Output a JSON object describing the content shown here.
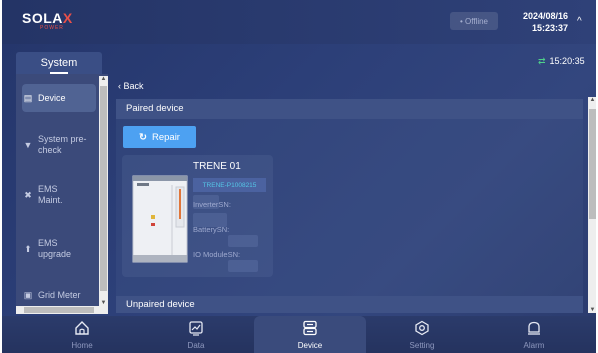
{
  "header": {
    "logo_main": "SOLA",
    "logo_x": "X",
    "logo_sub": "POWER",
    "status": "• Offline",
    "date": "2024/08/16",
    "time": "15:23:37"
  },
  "sidebar": {
    "title": "System",
    "items": [
      {
        "label": "Device",
        "icon": "device-icon",
        "active": true
      },
      {
        "label": "System pre-check",
        "icon": "precheck-icon",
        "active": false
      },
      {
        "label": "EMS Maint.",
        "icon": "wrench-icon",
        "active": false
      },
      {
        "label": "EMS upgrade",
        "icon": "upgrade-icon",
        "active": false
      },
      {
        "label": "Grid Meter",
        "icon": "meter-icon",
        "active": false
      }
    ]
  },
  "content": {
    "sync_time": "15:20:35",
    "back_label": "Back",
    "paired_title": "Paired device",
    "repair_label": "Repair",
    "device": {
      "name": "TRENE 01",
      "sn": "TRENE-P1008215",
      "inverter_label": "InverterSN:",
      "battery_label": "BatterySN:",
      "io_label": "IO ModuleSN:"
    },
    "unpaired_title": "Unpaired device"
  },
  "nav": [
    {
      "label": "Home",
      "icon": "home-icon",
      "active": false
    },
    {
      "label": "Data",
      "icon": "chart-icon",
      "active": false
    },
    {
      "label": "Device",
      "icon": "device-stack-icon",
      "active": true
    },
    {
      "label": "Setting",
      "icon": "setting-icon",
      "active": false
    },
    {
      "label": "Alarm",
      "icon": "alarm-icon",
      "active": false
    }
  ],
  "colors": {
    "accent": "#4da1f2",
    "sn_text": "#55c6e6",
    "sync_icon": "#4fd08a",
    "logo_x": "#e8504a"
  }
}
